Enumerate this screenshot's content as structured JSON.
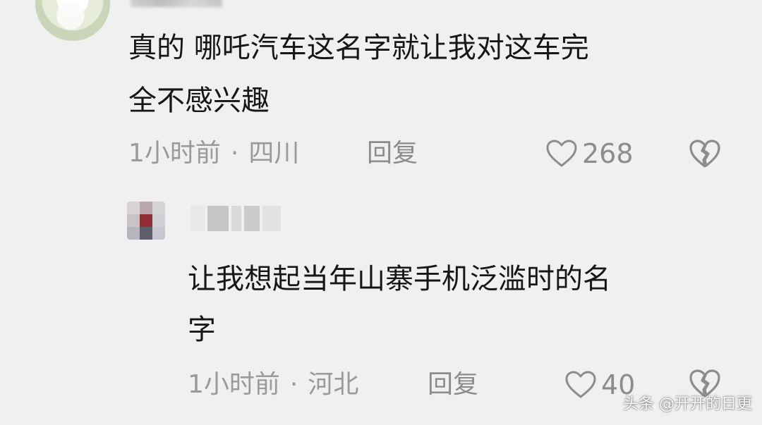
{
  "comment1": {
    "text_line1": "真的 哪吒汽车这名字就让我对这车完",
    "text_line2": "全不感兴趣",
    "time": "1小时前",
    "location": "四川",
    "reply_label": "回复",
    "likes": "268"
  },
  "comment2": {
    "text_line1": "让我想起当年山寨手机泛滥时的名",
    "text_line2": "字",
    "time": "1小时前",
    "location": "河北",
    "reply_label": "回复",
    "likes": "40"
  },
  "separator": "·",
  "watermark": "头条 @开开的日更",
  "icons": {
    "like": "heart-outline-icon",
    "dislike": "broken-heart-icon"
  },
  "colors": {
    "background": "#f0f0f0",
    "text": "#161616",
    "meta": "#9a9a9a"
  }
}
